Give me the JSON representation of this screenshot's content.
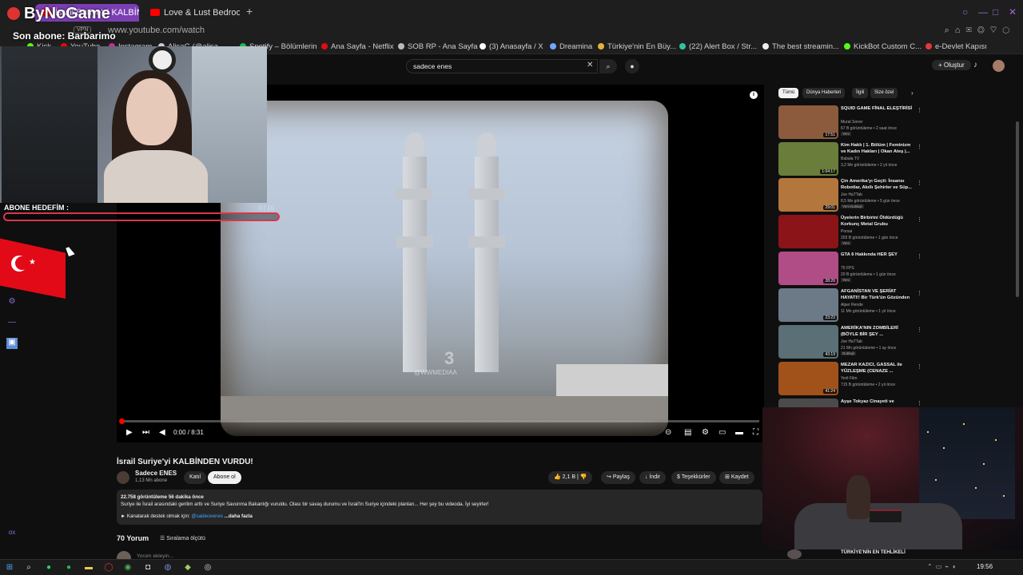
{
  "browser": {
    "tabs": [
      {
        "label": "İsrail Suriye'yi KALBİNDEN",
        "active": true
      },
      {
        "label": "Love & Lust Bedroom",
        "active": false
      }
    ],
    "new_tab": "+",
    "vpn": "VPN",
    "url": "www.youtube.com/watch",
    "bookmarks": [
      "Kick",
      "YouTube",
      "Instagram",
      "AlisaG (@alisa",
      "Spotify – Bölümlerin",
      "Ana Sayfa - Netflix",
      "SOB RP - Ana Sayfa",
      "(3) Anasayfa / X",
      "Dreamina",
      "Türkiye'nin En Büy...",
      "(22) Alert Box / Str...",
      "The best streamin...",
      "KickBot Custom C...",
      "e-Devlet Kapısı"
    ]
  },
  "overlay": {
    "logo": "ByNoGame",
    "last_sub": "Son abone: Barbarimo",
    "goal_label": "ABONE HEDEFİM :",
    "goal_current": "0",
    "goal_target": "/ 10",
    "goal_fraction": 0.0
  },
  "youtube": {
    "search_query": "sadece enes",
    "create_label": "Oluştur",
    "video": {
      "title": "İsrail Suriye'yi KALBİNDEN VURDU!",
      "watermark_big": "3",
      "watermark_small": "@WWMEDIAA",
      "time": "0:00 / 8:31",
      "progress": 0.0
    },
    "channel": {
      "name": "Sadece ENES",
      "subs": "1,13 Mn abone",
      "join": "Katıl",
      "subscribe": "Abone ol"
    },
    "actions": {
      "likes": "2,1 B",
      "share": "Paylaş",
      "download": "İndir",
      "thanks": "Teşekkürler",
      "save": "Kaydet"
    },
    "description": {
      "stats": "22.758 görüntüleme  56 dakika önce",
      "text": "Suriye ile İsrail arasındaki gerilim arttı ve Suriye Savunma Bakanlığı vuruldu. Olası bir savaş durumu ve İsrail'in Suriye içindeki planları... Her şey bu videoda. İyi seyirler!",
      "support": "► Kanalarak destek olmak için:",
      "handle": "@sadeceenes",
      "more": "...daha fazla"
    },
    "comments": {
      "count": "70 Yorum",
      "sort": "Sıralama ölçütü",
      "placeholder": "Yorum ekleyin..."
    },
    "chips": [
      "Tümü",
      "Dünya Haberleri",
      "İlgili",
      "Size özel"
    ],
    "recommendations": [
      {
        "title": "SQUID GAME FİNAL ELEŞTİRİSİ",
        "channel": "Murat Soner",
        "meta": "67 B görüntüleme • 2 saat önce",
        "badge": "Yeni",
        "duration": "17:51",
        "color": "#8c5b3e"
      },
      {
        "title": "Kim Haklı | 1. Bölüm | Feminizm ve Kadın Hakları | Okan Ateş |...",
        "channel": "Babala TV",
        "meta": "3,2 Mn görüntüleme • 2 yıl önce",
        "badge": "",
        "duration": "1:04:17",
        "color": "#6a7d3a"
      },
      {
        "title": "Çin Amerika'yı Geçti: İnsansı Robotlar, Akıllı Şehirler ve Süp...",
        "channel": "Joe HaTTab",
        "meta": "8,5 Mn görüntüleme • 5 gün önce",
        "badge": "Yeni  Dublajlı",
        "duration": "29:01",
        "color": "#b3763d"
      },
      {
        "title": "Üyelerin Birbirini Öldürdüğü Korkunç Metal Grubu",
        "channel": "Porsai",
        "meta": "203 B görüntüleme • 1 gün önce",
        "badge": "Yeni",
        "duration": "",
        "color": "#8b1418"
      },
      {
        "title": "GTA 6 Hakkında HER ŞEY",
        "channel": "75 FPS",
        "meta": "20 B görüntüleme • 1 gün önce",
        "badge": "Yeni",
        "duration": "28:26",
        "color": "#b04c86"
      },
      {
        "title": "AFGANİSTAN VE ŞERİAT HAYATI!! Bir Türk'ün Gözünden ...",
        "channel": "Alper Rende",
        "meta": "11 Mn görüntüleme • 1 yıl önce",
        "badge": "",
        "duration": "23:22",
        "color": "#6c7a88"
      },
      {
        "title": "AMERİKA'NIN ZOMBİLERİ (BÖYLE BİR ŞEY ...",
        "channel": "Joe HaTTab",
        "meta": "21 Mn görüntüleme • 1 ay önce",
        "badge": "Dublajlı",
        "duration": "43:19",
        "color": "#5a6f76"
      },
      {
        "title": "MEZAR KAZICI, GASSAL ile YÜZLEŞME (CENAZE ...",
        "channel": "Yerli Film",
        "meta": "715 B görüntüleme • 2 yıl önce",
        "badge": "",
        "duration": "41:24",
        "color": "#a0521a"
      },
      {
        "title": "Ayşe Tokyaz Cinayeti ve",
        "channel": "",
        "meta": "",
        "badge": "",
        "duration": "",
        "color": "#4b4b4b"
      }
    ],
    "bottom_rec_title": "TÜRKİYE'NİN EN TEHLİKELİ"
  },
  "taskbar": {
    "clock": "19:56"
  },
  "colors": {
    "accent": "#7b3fb4",
    "goal": "#d9364c",
    "yt_red": "#ff0000"
  }
}
